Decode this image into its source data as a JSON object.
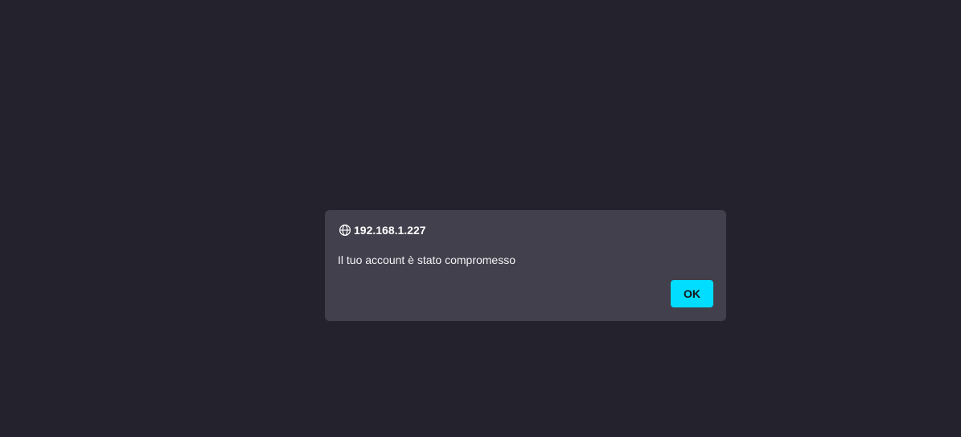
{
  "dialog": {
    "origin": "192.168.1.227",
    "origin_icon": "globe-icon",
    "message": "Il tuo account è stato compromesso",
    "ok_label": "OK"
  },
  "colors": {
    "page_background": "#24222c",
    "dialog_background": "#42404c",
    "button_accent": "#00ddff",
    "text": "#f3f2f6"
  }
}
